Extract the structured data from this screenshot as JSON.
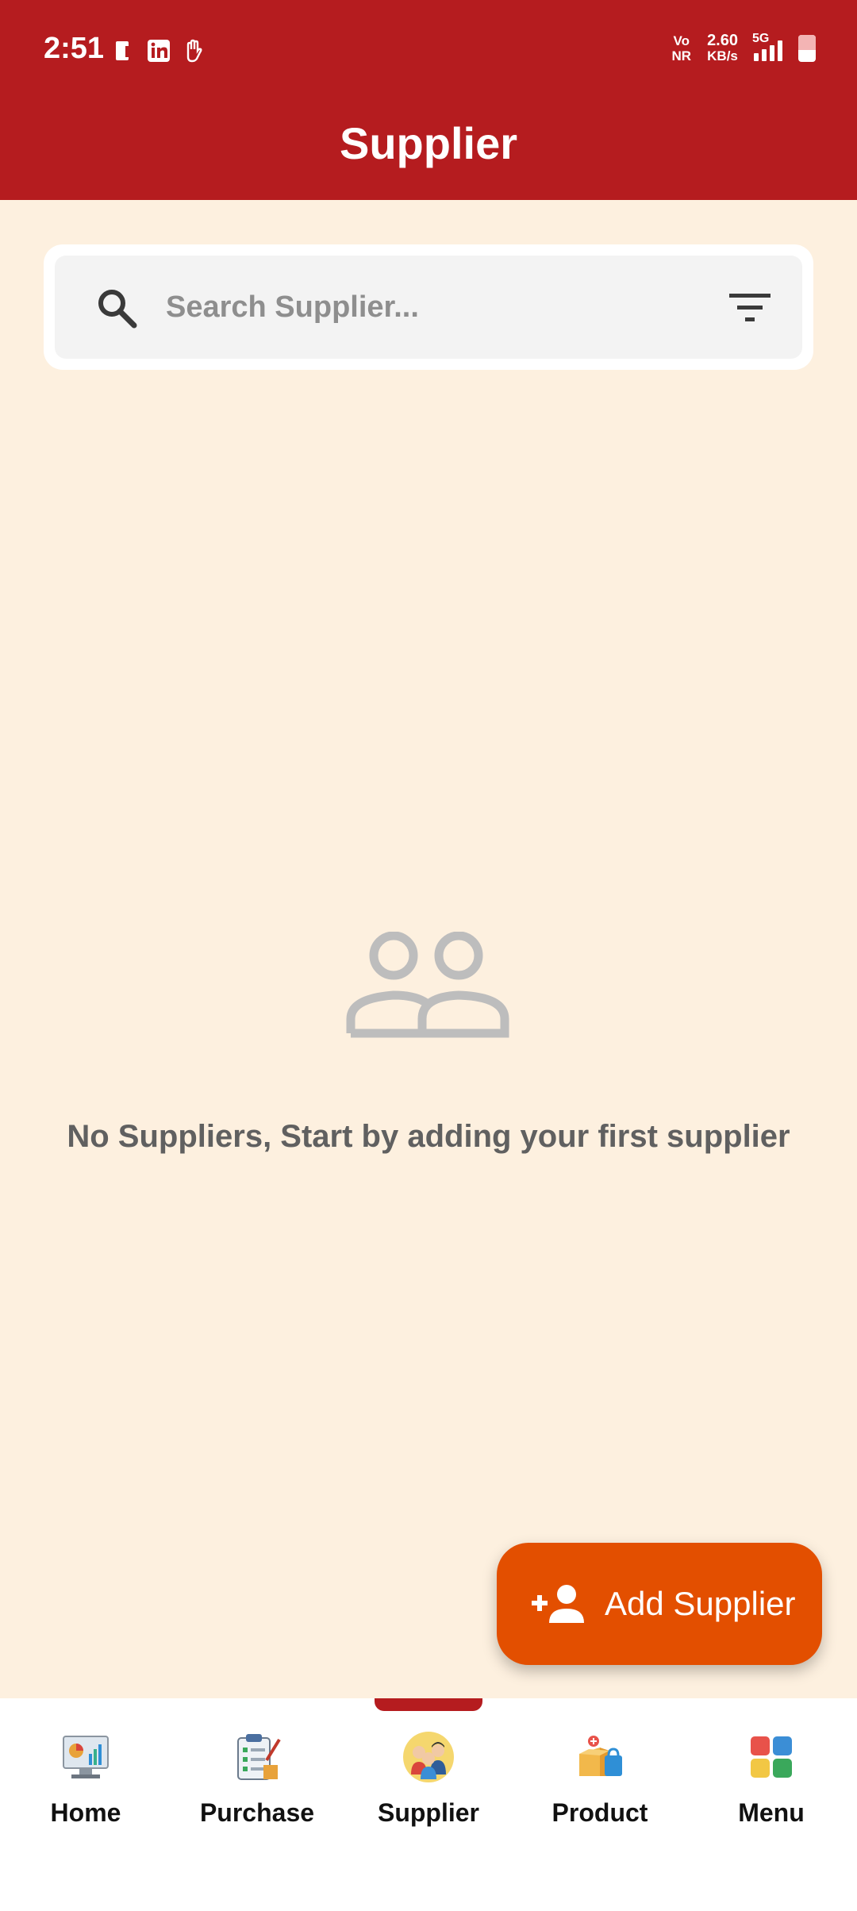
{
  "status_bar": {
    "time": "2:51",
    "network_type_top": "Vo",
    "network_type_bottom": "NR",
    "speed_value": "2.60",
    "speed_unit": "KB/s",
    "signal_label": "5G"
  },
  "header": {
    "title": "Supplier"
  },
  "search": {
    "placeholder": "Search Supplier..."
  },
  "empty_state": {
    "message": "No Suppliers, Start by adding your first supplier"
  },
  "fab": {
    "label": "Add Supplier"
  },
  "bottom_nav": {
    "active": "Supplier",
    "items": [
      {
        "label": "Home",
        "icon": "home-dashboard-icon"
      },
      {
        "label": "Purchase",
        "icon": "purchase-clipboard-icon"
      },
      {
        "label": "Supplier",
        "icon": "supplier-people-icon"
      },
      {
        "label": "Product",
        "icon": "product-box-icon"
      },
      {
        "label": "Menu",
        "icon": "menu-grid-icon"
      }
    ]
  },
  "colors": {
    "header": "#b51c1f",
    "background": "#fdf0df",
    "fab": "#e34f00"
  }
}
